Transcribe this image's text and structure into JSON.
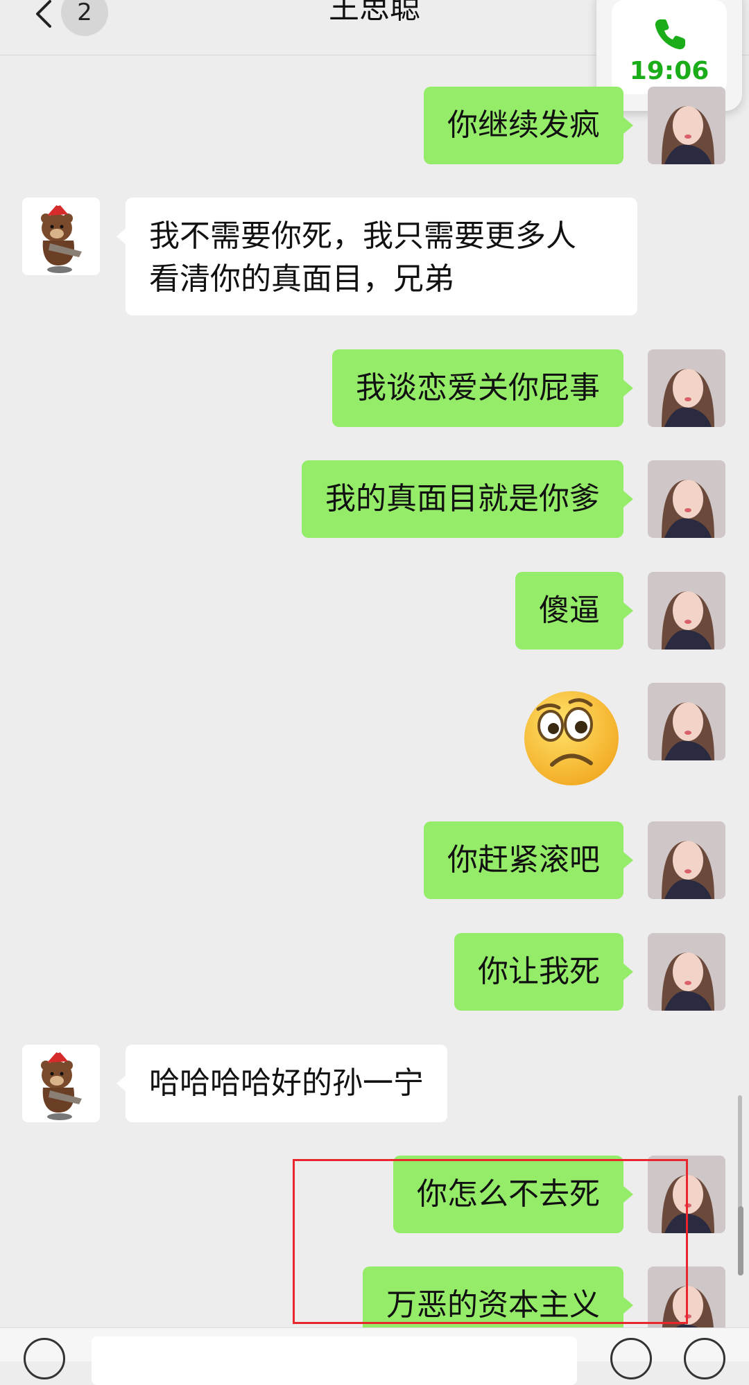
{
  "header": {
    "title": "王思聪",
    "unread_count": "2"
  },
  "call_float": {
    "time": "19:06"
  },
  "messages": [
    {
      "side": "right",
      "text": "你继续发疯"
    },
    {
      "side": "left",
      "lines": [
        "我不需要你死，我只需要更多人",
        "看清你的真面目，兄弟"
      ]
    },
    {
      "side": "right",
      "text": "我谈恋爱关你屁事"
    },
    {
      "side": "right",
      "text": "我的真面目就是你爹"
    },
    {
      "side": "right",
      "text": "傻逼"
    },
    {
      "side": "right",
      "sticker": "confused-face-emoji"
    },
    {
      "side": "right",
      "text": "你赶紧滚吧"
    },
    {
      "side": "right",
      "text": "你让我死"
    },
    {
      "side": "left",
      "text": "哈哈哈哈好的孙一宁"
    },
    {
      "side": "right",
      "text": "你怎么不去死"
    },
    {
      "side": "right",
      "text": "万恶的资本主义"
    }
  ],
  "colors": {
    "sent_bubble": "#95ec69",
    "received_bubble": "#ffffff",
    "background": "#ededed",
    "highlight_box": "#e8262b",
    "call_time": "#1aad19"
  }
}
